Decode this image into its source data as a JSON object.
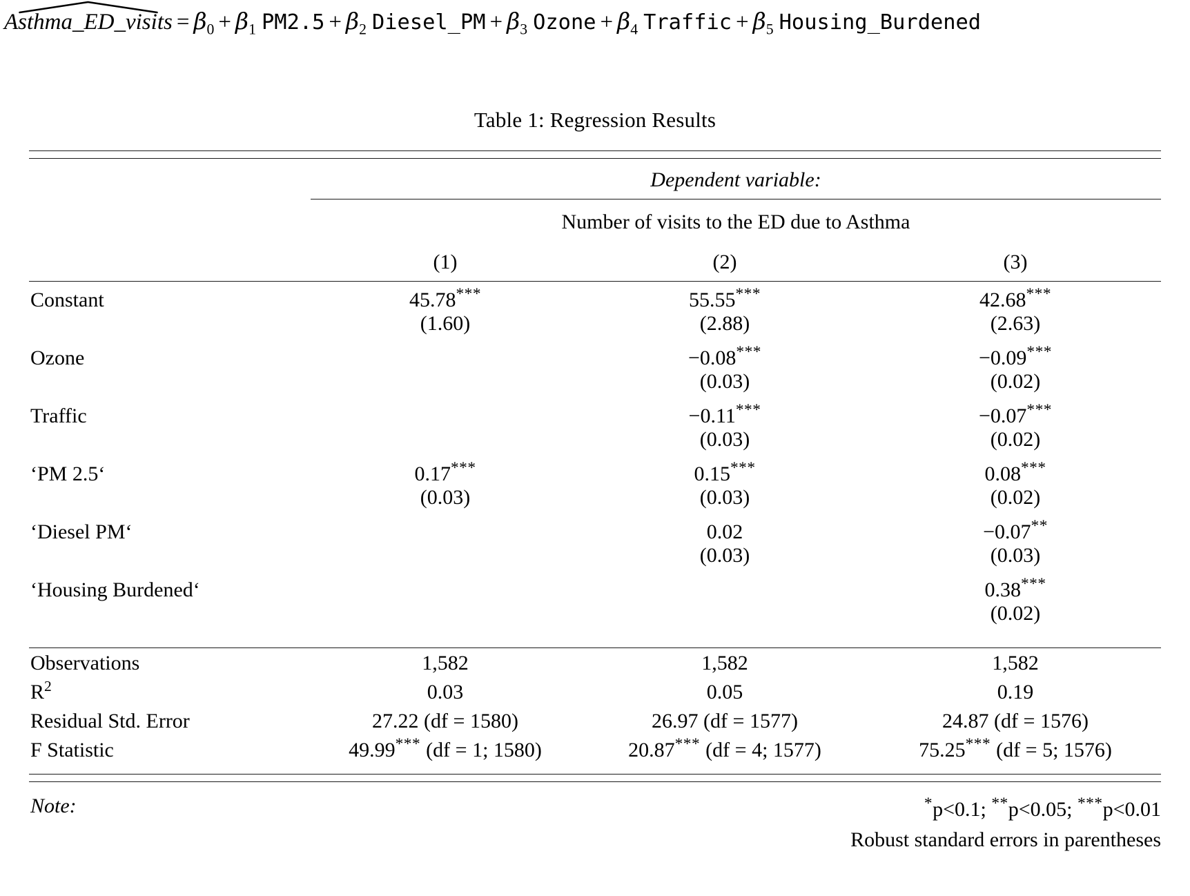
{
  "equation": {
    "lhs_text": "Asthma_ED_visits",
    "lhs_hatted": true,
    "equals": "=",
    "terms": [
      {
        "beta": "β",
        "sub": "0",
        "variable": ""
      },
      {
        "beta": "β",
        "sub": "1",
        "variable": "PM2.5"
      },
      {
        "beta": "β",
        "sub": "2",
        "variable": "Diesel_PM"
      },
      {
        "beta": "β",
        "sub": "3",
        "variable": "Ozone"
      },
      {
        "beta": "β",
        "sub": "4",
        "variable": "Traffic"
      },
      {
        "beta": "β",
        "sub": "5",
        "variable": "Housing_Burdened"
      }
    ],
    "plus": "+"
  },
  "table": {
    "caption": "Table 1: Regression Results",
    "dependent_variable_label": "Dependent variable:",
    "dependent_variable_name": "Number of visits to the ED due to Asthma",
    "column_headers": [
      "",
      "(1)",
      "(2)",
      "(3)"
    ],
    "rows": [
      {
        "name": "Constant",
        "coefs": [
          "45.78",
          "55.55",
          "42.68"
        ],
        "stars": [
          "***",
          "***",
          "***"
        ],
        "ses": [
          "(1.60)",
          "(2.88)",
          "(2.63)"
        ]
      },
      {
        "name": "Ozone",
        "coefs": [
          "",
          "−0.08",
          "−0.09"
        ],
        "stars": [
          "",
          "***",
          "***"
        ],
        "ses": [
          "",
          "(0.03)",
          "(0.02)"
        ]
      },
      {
        "name": "Traffic",
        "coefs": [
          "",
          "−0.11",
          "−0.07"
        ],
        "stars": [
          "",
          "***",
          "***"
        ],
        "ses": [
          "",
          "(0.03)",
          "(0.02)"
        ]
      },
      {
        "name": "‘PM 2.5‘",
        "coefs": [
          "0.17",
          "0.15",
          "0.08"
        ],
        "stars": [
          "***",
          "***",
          "***"
        ],
        "ses": [
          "(0.03)",
          "(0.03)",
          "(0.02)"
        ]
      },
      {
        "name": "‘Diesel PM‘",
        "coefs": [
          "",
          "0.02",
          "−0.07"
        ],
        "stars": [
          "",
          "",
          "**"
        ],
        "ses": [
          "",
          "(0.03)",
          "(0.03)"
        ]
      },
      {
        "name": "‘Housing Burdened‘",
        "coefs": [
          "",
          "",
          "0.38"
        ],
        "stars": [
          "",
          "",
          "***"
        ],
        "ses": [
          "",
          "",
          "(0.02)"
        ]
      }
    ],
    "stats": [
      {
        "label": "Observations",
        "values": [
          "1,582",
          "1,582",
          "1,582"
        ]
      },
      {
        "label_html": "R2",
        "label_base": "R",
        "label_sup": "2",
        "values": [
          "0.03",
          "0.05",
          "0.19"
        ]
      },
      {
        "label": "Residual Std. Error",
        "values": [
          "27.22 (df = 1580)",
          "26.97 (df = 1577)",
          "24.87 (df = 1576)"
        ]
      },
      {
        "label": "F Statistic",
        "values": [
          "49.99*** (df = 1; 1580)",
          "20.87*** (df = 4; 1577)",
          "75.25*** (df = 5; 1576)"
        ],
        "value_parts": [
          {
            "num": "49.99",
            "stars": "***",
            "df": "(df = 1; 1580)"
          },
          {
            "num": "20.87",
            "stars": "***",
            "df": "(df = 4; 1577)"
          },
          {
            "num": "75.25",
            "stars": "***",
            "df": "(df = 5; 1576)"
          }
        ]
      }
    ],
    "note": {
      "label": "Note:",
      "significance": "*p<0.1; **p<0.05; ***p<0.01",
      "significance_parts": [
        {
          "stars": "*",
          "text": "p<0.1;"
        },
        {
          "stars": "**",
          "text": "p<0.05;"
        },
        {
          "stars": "***",
          "text": "p<0.01"
        }
      ],
      "standard_errors": "Robust standard errors in parentheses"
    }
  },
  "colors": {
    "text": "#000000",
    "rule": "#1a1a1a",
    "background": "#ffffff"
  }
}
